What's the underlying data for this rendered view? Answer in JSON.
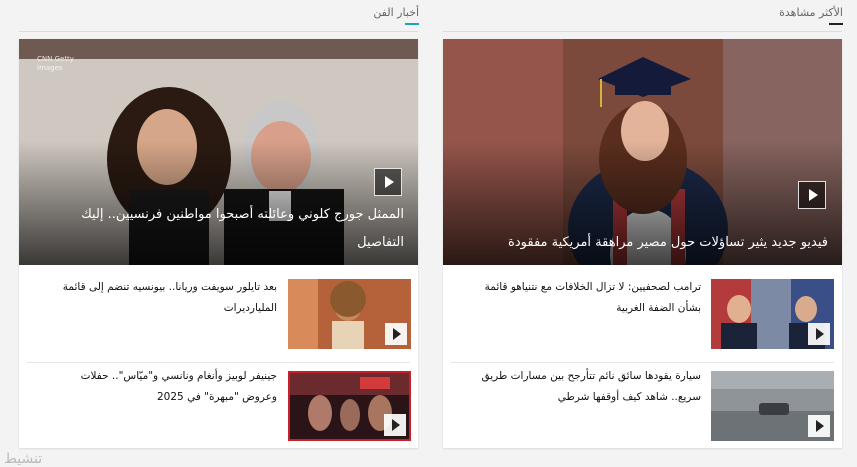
{
  "sections": {
    "most_viewed": {
      "title": "الأكثر مشاهدة",
      "hero_caption": "فيديو جديد يثير تساؤلات حول مصير مراهقة أمريكية مفقودة",
      "items": [
        {
          "headline": "ترامب لصحفيين: لا تزال الخلافات مع نتنياهو قائمة بشأن الضفة الغربية"
        },
        {
          "headline": "سيارة يقودها سائق نائم تتأرجح بين مسارات طريق سريع.. شاهد كيف أوقفها شرطي"
        }
      ]
    },
    "arts_news": {
      "title": "أخبار الفن",
      "hero_caption": "الممثل جورج كلوني وعائلته أصبحوا مواطنين فرنسيين.. إليك التفاصيل",
      "hero_watermark": "CNN Getty Images",
      "items": [
        {
          "headline": "بعد تايلور سويفت وريانا.. بيونسيه تنضم إلى قائمة المليارديرات"
        },
        {
          "headline": "جينيفر لوبيز وأنغام ونانسي و\"ميّاس\".. حفلات وعروض \"مبهرة\" في 2025"
        }
      ]
    }
  },
  "watermark_text": "تنشيط",
  "colors": {
    "accent_teal": "#1aa4b8",
    "accent_dark": "#222222"
  },
  "icons": {
    "play": "play-icon"
  }
}
